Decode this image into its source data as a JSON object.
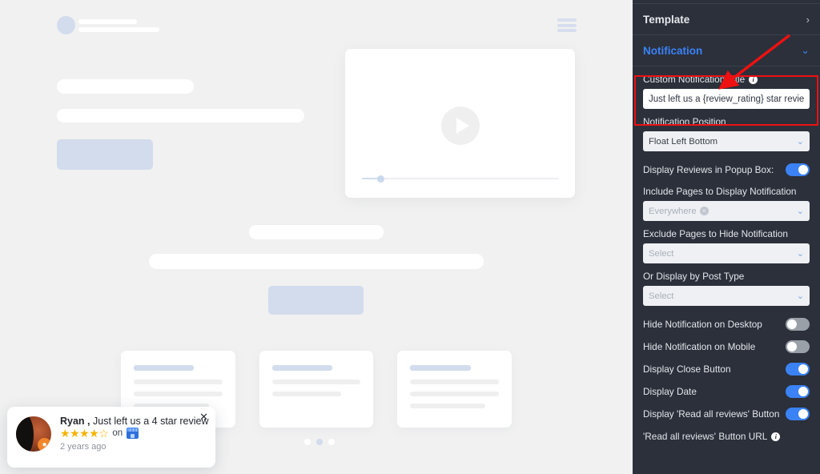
{
  "preview": {
    "hamburger_icon": "hamburger-menu-icon",
    "play_icon": "play-button-icon",
    "pagination": {
      "total": 3,
      "active_index": 1
    }
  },
  "notification": {
    "name": "Ryan ,",
    "message": "Just left us a 4 star review",
    "rating": 4,
    "rating_max": 5,
    "star_filled": "★",
    "star_empty": "☆",
    "on_label": "on",
    "source_icon": "google-business-profile-icon",
    "date": "2 years ago",
    "close_icon": "✕"
  },
  "sidebar": {
    "accordions": [
      {
        "label": "Template",
        "chevron": "›",
        "active": false
      },
      {
        "label": "Notification",
        "chevron": "⌄",
        "active": true
      }
    ],
    "fields": {
      "custom_title": {
        "label": "Custom Notification Title",
        "info_icon": "info-icon",
        "value": "Just left us a {review_rating} star review"
      },
      "position": {
        "label": "Notification Position",
        "value": "Float Left Bottom",
        "chevron": "⌄"
      },
      "display_reviews_popup": {
        "label": "Display Reviews in Popup Box:",
        "on": true
      },
      "include_pages": {
        "label": "Include Pages to Display Notification",
        "value": "Everywhere",
        "tag_remove_icon": "×",
        "chevron": "⌄"
      },
      "exclude_pages": {
        "label": "Exclude Pages to Hide Notification",
        "placeholder": "Select",
        "chevron": "⌄"
      },
      "post_type": {
        "label": "Or Display by Post Type",
        "placeholder": "Select",
        "chevron": "⌄"
      },
      "hide_desktop": {
        "label": "Hide Notification on Desktop",
        "on": false
      },
      "hide_mobile": {
        "label": "Hide Notification on Mobile",
        "on": false
      },
      "close_button": {
        "label": "Display Close Button",
        "on": true
      },
      "display_date": {
        "label": "Display Date",
        "on": true
      },
      "read_all_button": {
        "label": "Display 'Read all reviews' Button",
        "on": true
      },
      "read_all_url": {
        "label": "'Read all reviews' Button URL",
        "info_icon": "info-icon"
      }
    }
  },
  "annotation": {
    "highlight_color": "#ee1111",
    "arrow_color": "#ee1111"
  },
  "colors": {
    "sidebar_bg": "#2b303b",
    "accent_blue": "#3b82f6",
    "preview_bg": "#f1f1f1",
    "skeleton_blue": "#d2dced",
    "star_gold": "#f5b301"
  }
}
